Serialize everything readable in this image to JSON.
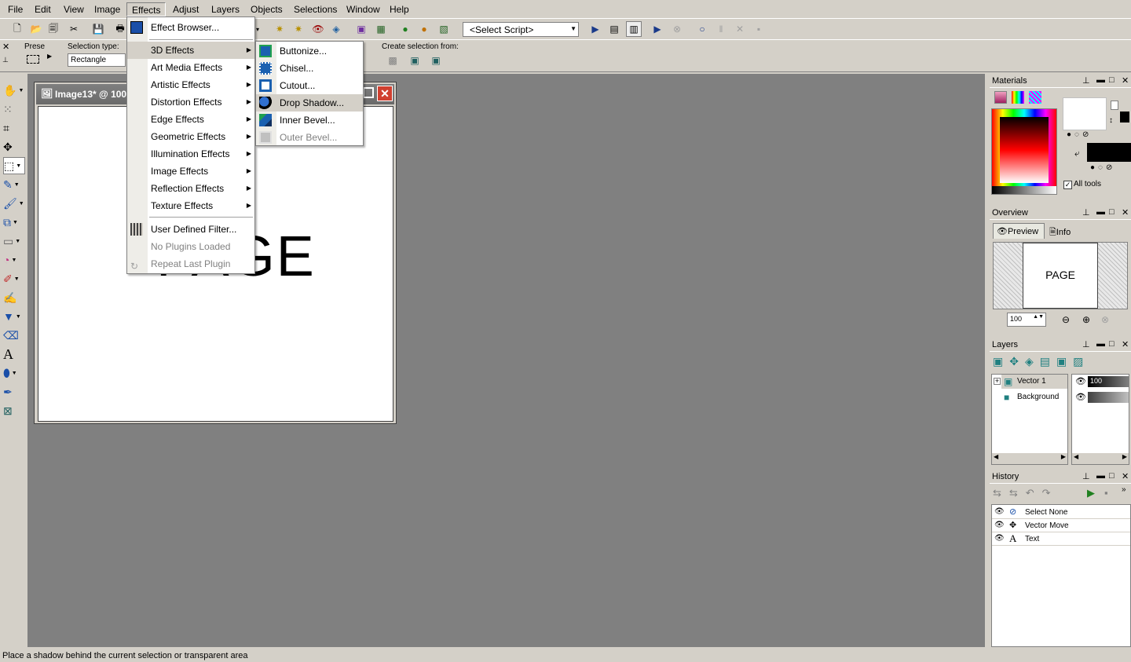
{
  "menubar": [
    "File",
    "Edit",
    "View",
    "Image",
    "Effects",
    "Adjust",
    "Layers",
    "Objects",
    "Selections",
    "Window",
    "Help"
  ],
  "toolbar": {
    "script_select": "<Select Script>"
  },
  "tool_options": {
    "presets_label": "Prese",
    "selection_type_label": "Selection type:",
    "selection_type_value": "Rectangle",
    "create_selection_label": "Create selection from:"
  },
  "document": {
    "title": "Image13* @ 100%",
    "canvas_text": "PAGE"
  },
  "effects_menu": {
    "items": [
      {
        "label": "Effect Browser...",
        "submenu": false
      },
      {
        "label": "3D Effects",
        "submenu": true
      },
      {
        "label": "Art Media Effects",
        "submenu": true
      },
      {
        "label": "Artistic Effects",
        "submenu": true
      },
      {
        "label": "Distortion Effects",
        "submenu": true
      },
      {
        "label": "Edge Effects",
        "submenu": true
      },
      {
        "label": "Geometric Effects",
        "submenu": true
      },
      {
        "label": "Illumination Effects",
        "submenu": true
      },
      {
        "label": "Image Effects",
        "submenu": true
      },
      {
        "label": "Reflection Effects",
        "submenu": true
      },
      {
        "label": "Texture Effects",
        "submenu": true
      },
      {
        "label": "User Defined Filter...",
        "submenu": false
      },
      {
        "label": "No Plugins Loaded",
        "submenu": false
      },
      {
        "label": "Repeat Last Plugin",
        "submenu": false
      }
    ]
  },
  "effects_3d_submenu": {
    "items": [
      "Buttonize...",
      "Chisel...",
      "Cutout...",
      "Drop Shadow...",
      "Inner Bevel...",
      "Outer Bevel..."
    ]
  },
  "materials_panel": {
    "title": "Materials",
    "all_tools_label": "All tools"
  },
  "overview_panel": {
    "title": "Overview",
    "tab_preview": "Preview",
    "tab_info": "Info",
    "preview_text": "PAGE",
    "zoom_value": "100"
  },
  "layers_panel": {
    "title": "Layers",
    "layers": [
      {
        "name": "Vector 1",
        "opacity": "100"
      },
      {
        "name": "Background",
        "opacity": ""
      }
    ]
  },
  "history_panel": {
    "title": "History",
    "items": [
      "Select None",
      "Vector Move",
      "Text"
    ]
  },
  "status": "Place a shadow behind the current selection or transparent area",
  "colors": {
    "chrome": "#d4d0c8",
    "workspace": "#808080",
    "highlight": "#d4d0c8"
  }
}
